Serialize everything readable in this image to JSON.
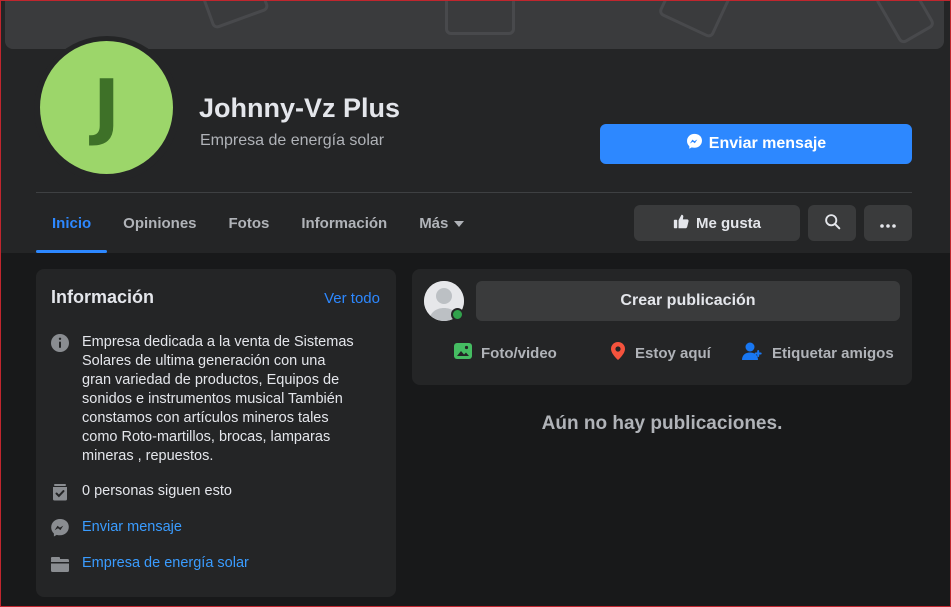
{
  "page": {
    "avatar_letter": "J",
    "name": "Johnny-Vz Plus",
    "category": "Empresa de energía solar"
  },
  "header": {
    "send_message_label": "Enviar mensaje",
    "tabs": [
      {
        "label": "Inicio",
        "active": true
      },
      {
        "label": "Opiniones",
        "active": false
      },
      {
        "label": "Fotos",
        "active": false
      },
      {
        "label": "Información",
        "active": false
      },
      {
        "label": "Más",
        "active": false
      }
    ],
    "like_label": "Me gusta"
  },
  "info": {
    "title": "Información",
    "see_all": "Ver todo",
    "description_lines": [
      "Empresa dedicada a la venta de Sistemas",
      "Solares de ultima generación con una",
      "gran variedad de productos, Equipos de",
      "sonidos e instrumentos musical También",
      "constamos con artículos mineros tales",
      "como Roto-martillos, brocas, lamparas",
      "mineras , repuestos."
    ],
    "followers": "0 personas siguen esto",
    "message": "Enviar mensaje",
    "category": "Empresa de energía solar"
  },
  "composer": {
    "create_post": "Crear publicación",
    "photo_video": "Foto/video",
    "check_in": "Estoy aquí",
    "tag_friends": "Etiquetar amigos"
  },
  "feed": {
    "empty_text": "Aún no hay publicaciones."
  },
  "colors": {
    "accent": "#2d88ff",
    "avatar_bg": "#9cd66a",
    "avatar_fg": "#3e7128",
    "online": "#31a24c",
    "photo_icon": "#45bd62",
    "checkin_icon": "#f5533d",
    "tag_icon": "#1877f2"
  },
  "icons": {
    "messenger": "messenger-icon",
    "like": "thumbs-up-icon",
    "search": "search-icon",
    "more": "ellipsis-icon",
    "info": "info-icon",
    "followers": "followers-check-icon",
    "category": "briefcase-icon"
  }
}
